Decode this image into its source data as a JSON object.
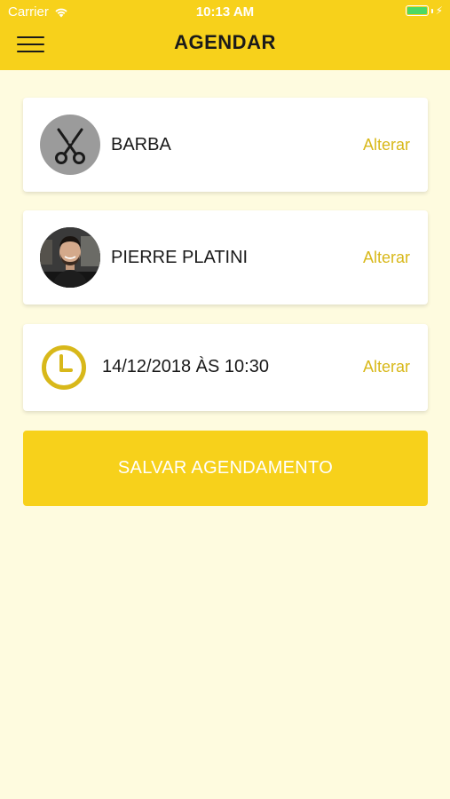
{
  "status_bar": {
    "carrier": "Carrier",
    "time": "10:13 AM"
  },
  "header": {
    "title": "AGENDAR",
    "background": "#f7d11b"
  },
  "booking": {
    "service": {
      "label": "BARBA",
      "icon": "scissors-icon",
      "change_label": "Alterar"
    },
    "professional": {
      "label": "PIERRE PLATINI",
      "icon": "avatar-photo",
      "change_label": "Alterar"
    },
    "datetime": {
      "label": "14/12/2018 ÀS 10:30",
      "icon": "clock-icon",
      "change_label": "Alterar"
    }
  },
  "actions": {
    "save_label": "SALVAR AGENDAMENTO"
  },
  "colors": {
    "accent": "#f7d11b",
    "link": "#d8b81a",
    "page_background": "#fefbdf"
  }
}
